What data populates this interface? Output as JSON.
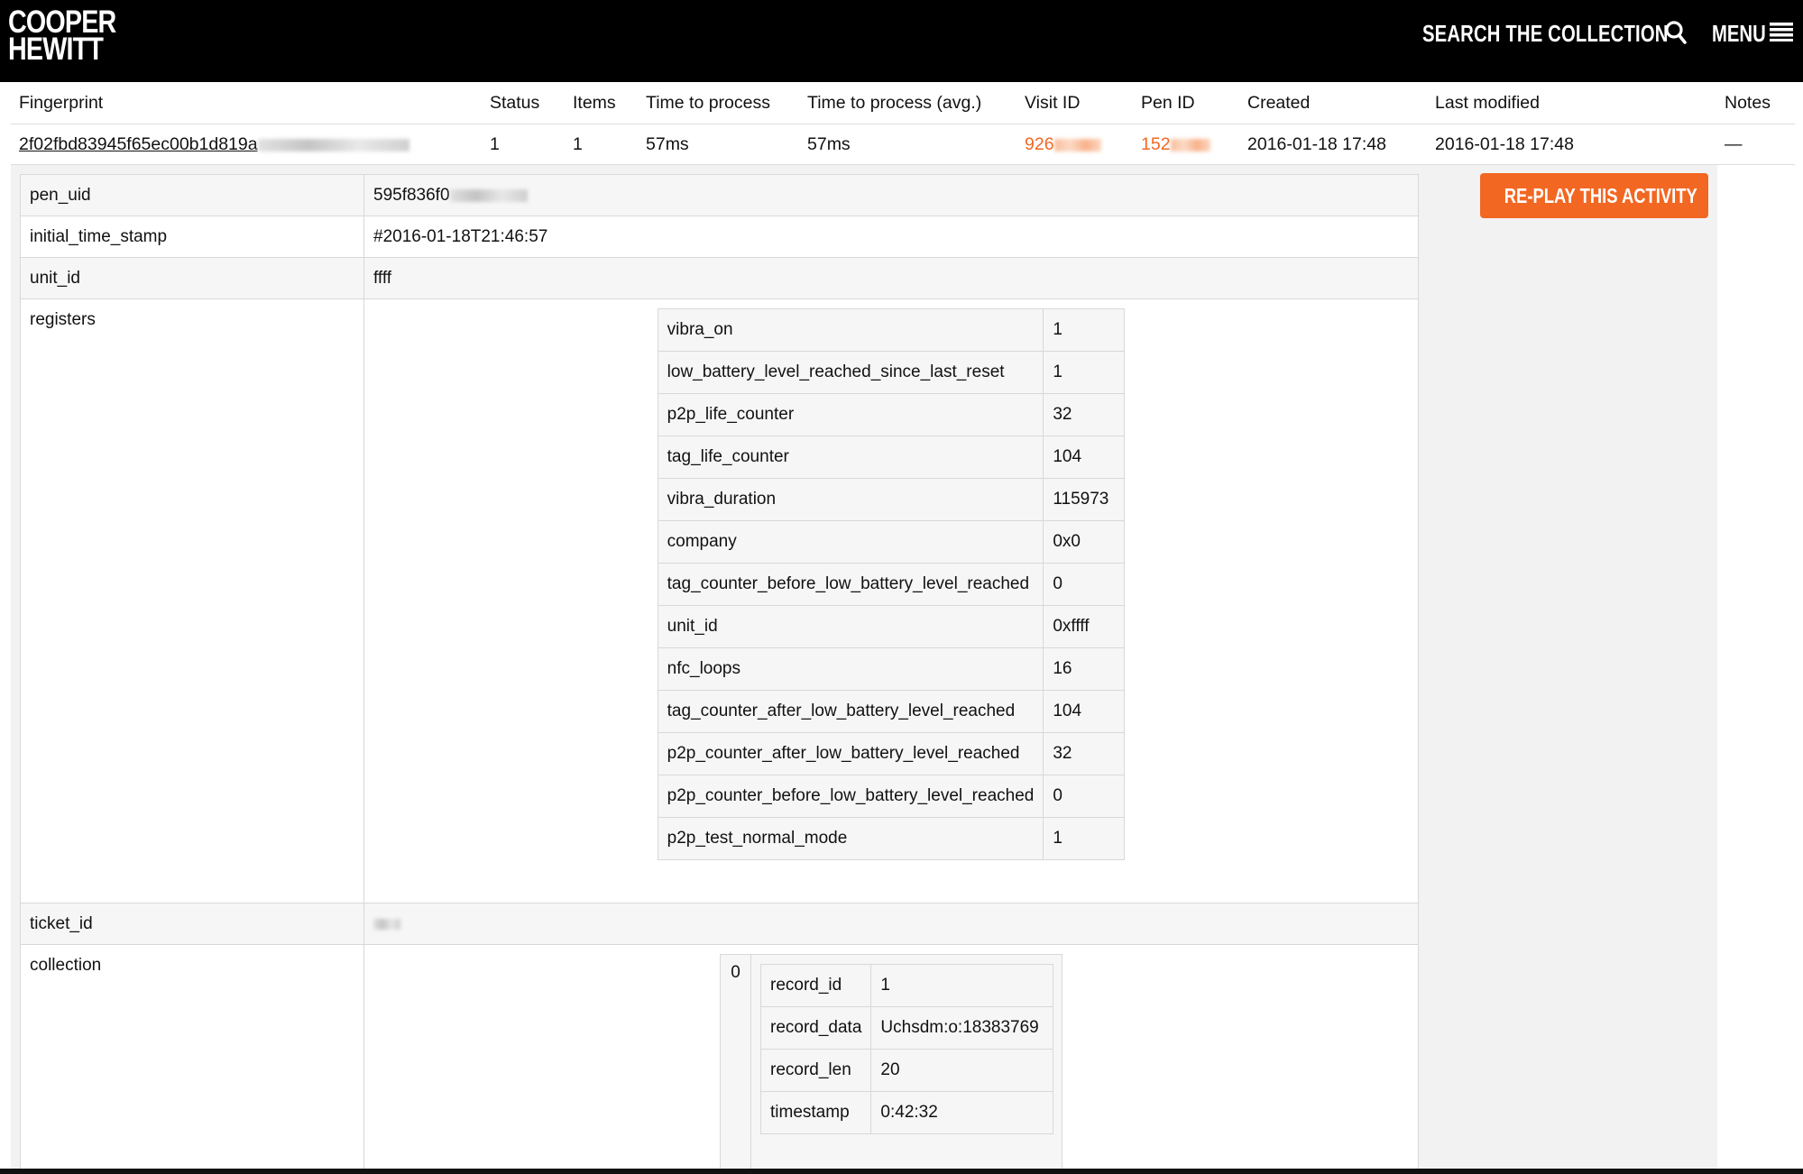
{
  "header": {
    "logo_line1": "COOPER",
    "logo_line2": "HEWITT",
    "search_label": "SEARCH THE COLLECTION",
    "menu_label": "MENU"
  },
  "summary": {
    "columns": [
      "Fingerprint",
      "Status",
      "Items",
      "Time to process",
      "Time to process (avg.)",
      "Visit ID",
      "Pen ID",
      "Created",
      "Last modified",
      "Notes"
    ],
    "row": {
      "fingerprint": "2f02fbd83945f65ec00b1d819a",
      "status": "1",
      "items": "1",
      "time_to_process": "57ms",
      "time_to_process_avg": "57ms",
      "visit_id": "926",
      "pen_id": "152",
      "created": "2016-01-18 17:48",
      "last_modified": "2016-01-18 17:48",
      "notes": "—"
    }
  },
  "detail": {
    "pen_uid_label": "pen_uid",
    "pen_uid_value": "595f836f0",
    "initial_time_stamp_label": "initial_time_stamp",
    "initial_time_stamp_value": "#2016-01-18T21:46:57",
    "unit_id_label": "unit_id",
    "unit_id_value": "ffff",
    "registers_label": "registers",
    "registers": [
      {
        "key": "vibra_on",
        "value": "1"
      },
      {
        "key": "low_battery_level_reached_since_last_reset",
        "value": "1"
      },
      {
        "key": "p2p_life_counter",
        "value": "32"
      },
      {
        "key": "tag_life_counter",
        "value": "104"
      },
      {
        "key": "vibra_duration",
        "value": "115973"
      },
      {
        "key": "company",
        "value": "0x0"
      },
      {
        "key": "tag_counter_before_low_battery_level_reached",
        "value": "0"
      },
      {
        "key": "unit_id",
        "value": "0xffff"
      },
      {
        "key": "nfc_loops",
        "value": "16"
      },
      {
        "key": "tag_counter_after_low_battery_level_reached",
        "value": "104"
      },
      {
        "key": "p2p_counter_after_low_battery_level_reached",
        "value": "32"
      },
      {
        "key": "p2p_counter_before_low_battery_level_reached",
        "value": "0"
      },
      {
        "key": "p2p_test_normal_mode",
        "value": "1"
      }
    ],
    "ticket_id_label": "ticket_id",
    "collection_label": "collection",
    "collection_index": "0",
    "collection": [
      {
        "key": "record_id",
        "value": "1"
      },
      {
        "key": "record_data",
        "value": "Uchsdm:o:18383769"
      },
      {
        "key": "record_len",
        "value": "20"
      },
      {
        "key": "timestamp",
        "value": "0:42:32"
      }
    ]
  },
  "replay_button_label": "RE-PLAY THIS ACTIVITY",
  "colors": {
    "accent": "#f26722",
    "header_bg": "#000000"
  }
}
